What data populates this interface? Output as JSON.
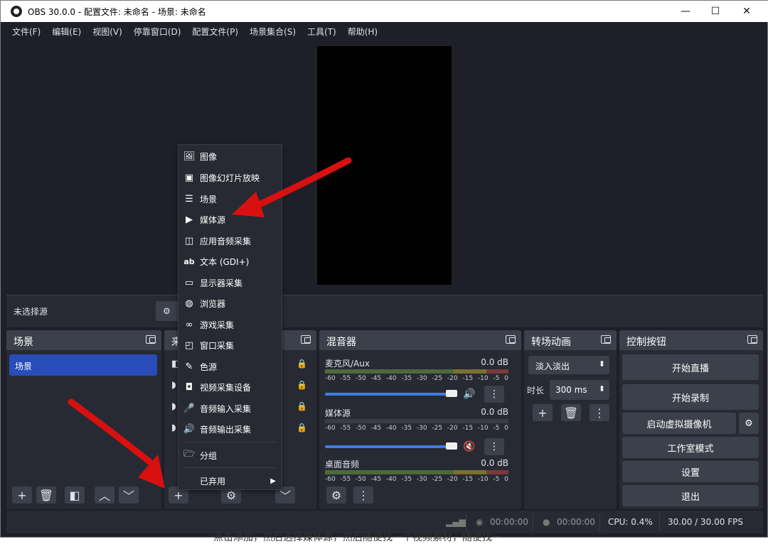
{
  "window": {
    "title": "OBS 30.0.0 - 配置文件: 未命名 - 场景: 未命名",
    "minimize": "—",
    "maximize": "☐",
    "close": "✕"
  },
  "menubar": [
    "文件(F)",
    "编辑(E)",
    "视图(V)",
    "停靠窗口(D)",
    "配置文件(P)",
    "场景集合(S)",
    "工具(T)",
    "帮助(H)"
  ],
  "source_toolbar": {
    "no_source": "未选择源",
    "properties_icon": "gear-icon"
  },
  "docks": {
    "scenes": {
      "title": "场景",
      "items": [
        "场景"
      ]
    },
    "sources": {
      "title": "来"
    },
    "mixer": {
      "title": "混音器",
      "channels": [
        {
          "name": "麦克风/Aux",
          "db": "0.0 dB",
          "muted": false
        },
        {
          "name": "媒体源",
          "db": "0.0 dB",
          "muted": true
        },
        {
          "name": "桌面音频",
          "db": "0.0 dB",
          "muted": false
        }
      ],
      "ticks": [
        "-60",
        "-55",
        "-50",
        "-45",
        "-40",
        "-35",
        "-30",
        "-25",
        "-20",
        "-15",
        "-10",
        "-5",
        "0"
      ]
    },
    "transitions": {
      "title": "转场动画",
      "selected": "淡入淡出",
      "duration_label": "时长",
      "duration_value": "300 ms"
    },
    "controls": {
      "title": "控制按钮",
      "start_stream": "开始直播",
      "start_record": "开始录制",
      "virtual_cam": "启动虚拟摄像机",
      "studio_mode": "工作室模式",
      "settings": "设置",
      "exit": "退出"
    }
  },
  "context_menu": {
    "items": [
      {
        "label": "图像",
        "icon": "image-icon"
      },
      {
        "label": "图像幻灯片放映",
        "icon": "slideshow-icon"
      },
      {
        "label": "场景",
        "icon": "list-icon"
      },
      {
        "label": "媒体源",
        "icon": "play-icon"
      },
      {
        "label": "应用音频采集",
        "icon": "app-audio-icon"
      },
      {
        "label": "文本 (GDI+)",
        "icon": "text-icon"
      },
      {
        "label": "显示器采集",
        "icon": "monitor-icon"
      },
      {
        "label": "浏览器",
        "icon": "globe-icon"
      },
      {
        "label": "游戏采集",
        "icon": "gamepad-icon"
      },
      {
        "label": "窗口采集",
        "icon": "window-icon"
      },
      {
        "label": "色源",
        "icon": "brush-icon"
      },
      {
        "label": "视频采集设备",
        "icon": "camera-icon"
      },
      {
        "label": "音频输入采集",
        "icon": "mic-icon"
      },
      {
        "label": "音频输出采集",
        "icon": "speaker-icon"
      }
    ],
    "group": "分组",
    "deprecated": "已弃用"
  },
  "statusbar": {
    "stream_time": "00:00:00",
    "record_time": "00:00:00",
    "cpu": "CPU: 0.4%",
    "fps": "30.00 / 30.00 FPS"
  },
  "footer": "点击添加，然后选择媒体源，然后随便找一个视频素材，随便找一"
}
